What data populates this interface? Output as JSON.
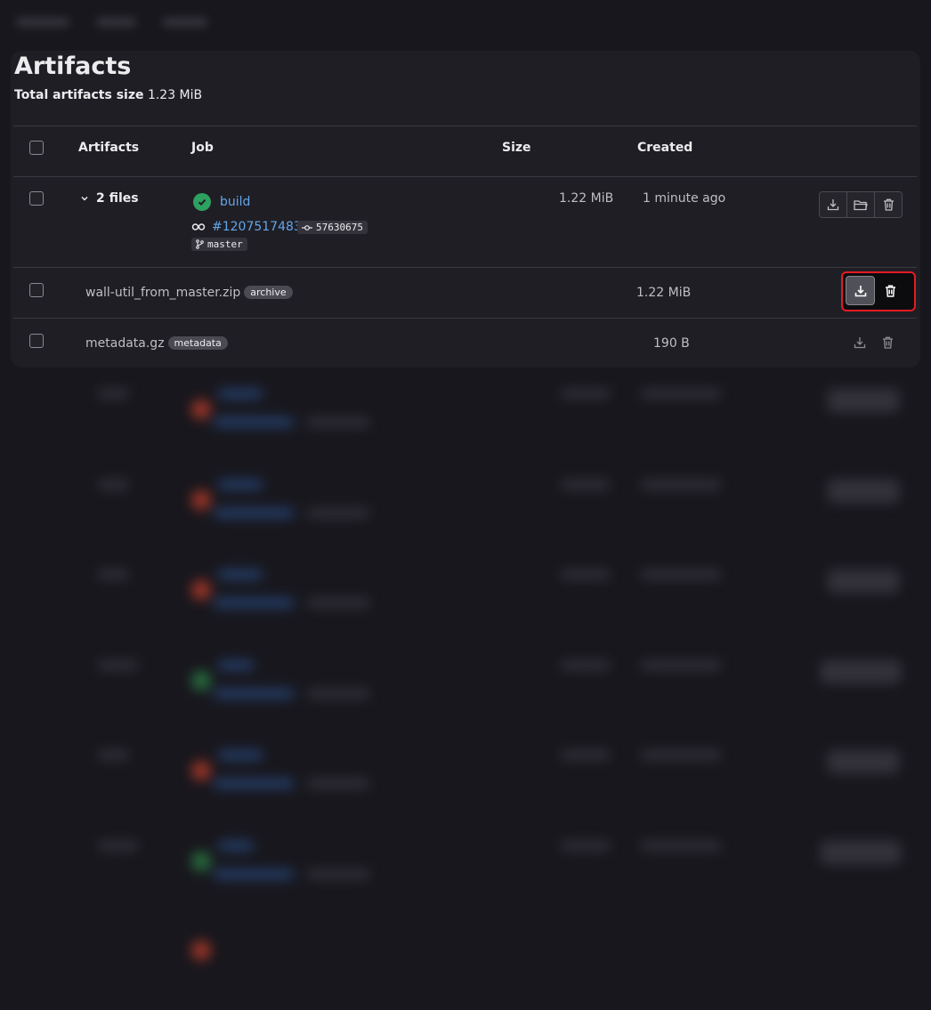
{
  "page": {
    "title": "Artifacts",
    "total_label": "Total artifacts size",
    "total_value": "1.23 MiB"
  },
  "table": {
    "headers": [
      "Artifacts",
      "Job",
      "Size",
      "Created"
    ]
  },
  "job_row": {
    "files_toggle": "2 files",
    "job_name": "build",
    "pipeline_id": "#1207517483",
    "commit": "57630675",
    "branch": "master",
    "size": "1.22 MiB",
    "created": "1 minute ago",
    "status": "success",
    "actions": [
      "download-icon",
      "browse-icon",
      "delete-icon"
    ]
  },
  "files": [
    {
      "name": "wall-util_from_master.zip",
      "type": "archive",
      "size": "1.22 MiB"
    },
    {
      "name": "metadata.gz",
      "type": "metadata",
      "size": "190 B"
    }
  ],
  "colors": {
    "background": "#18171d",
    "card": "#1f1e24",
    "link": "#63a6e9",
    "success": "#2da160",
    "highlight": "#e31b23"
  }
}
